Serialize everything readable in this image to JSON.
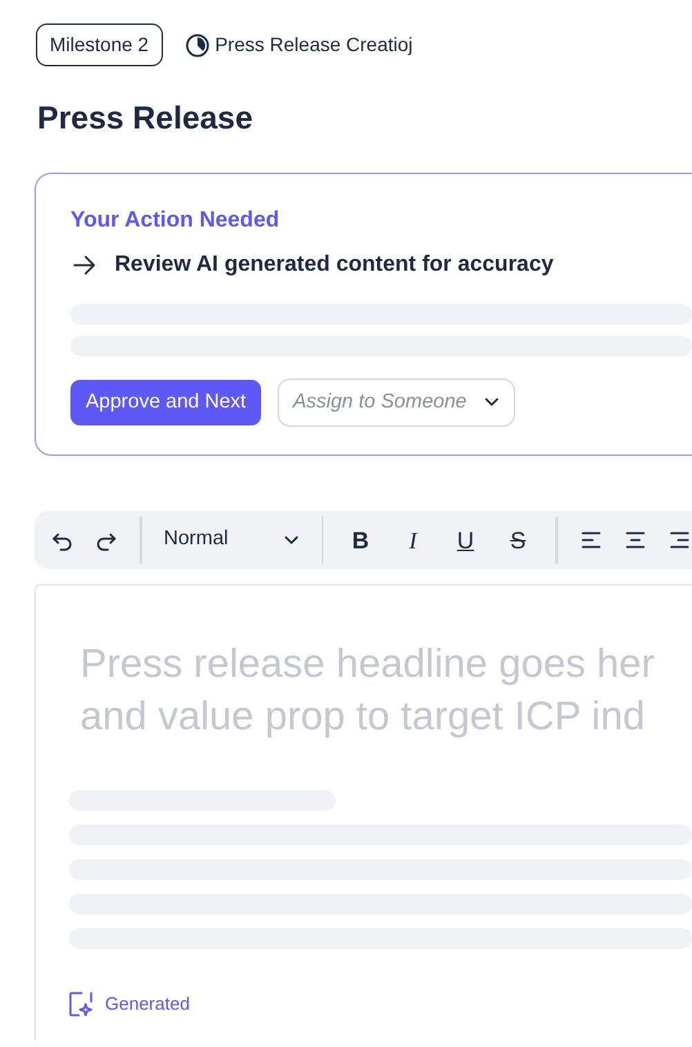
{
  "breadcrumb": {
    "milestone": "Milestone 2",
    "task": "Press Release Creatioj"
  },
  "page_title": "Press Release",
  "action_card": {
    "heading": "Your Action Needed",
    "instruction": "Review AI generated content for accuracy",
    "primary_button": "Approve and Next",
    "assign_dropdown": {
      "placeholder": "Assign to Someone"
    }
  },
  "toolbar": {
    "style_select": "Normal",
    "format_buttons": [
      {
        "kind": "bold",
        "label": "B"
      },
      {
        "kind": "italic",
        "label": "I"
      },
      {
        "kind": "underline",
        "label": "U"
      },
      {
        "kind": "strike",
        "label": "S"
      }
    ]
  },
  "editor": {
    "headline_placeholder": "Press release headline goes her\nand value prop to target ICP ind",
    "footer_tag": "Generated"
  }
}
